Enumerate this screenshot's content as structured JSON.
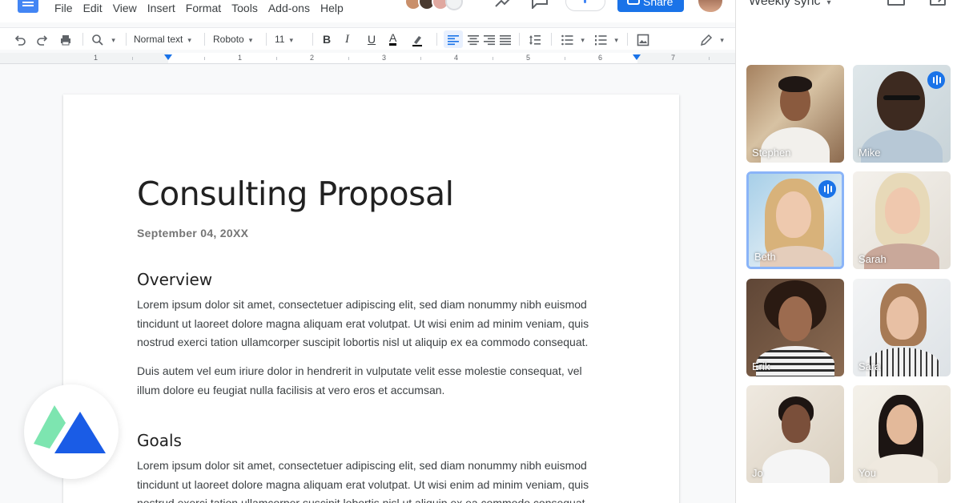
{
  "menubar": {
    "items": [
      "File",
      "Edit",
      "View",
      "Insert",
      "Format",
      "Tools",
      "Add-ons",
      "Help"
    ],
    "share_label": "Share"
  },
  "toolbar": {
    "style_select": "Normal text",
    "font_select": "Roboto",
    "size_select": "11",
    "bold_label": "B",
    "italic_label": "I",
    "underline_label": "U",
    "text_color_label": "A"
  },
  "ruler": {
    "marks": [
      "1",
      "1",
      "2",
      "3",
      "4",
      "5",
      "6",
      "7"
    ]
  },
  "document": {
    "title": "Consulting Proposal",
    "date": "September 04, 20XX",
    "sections": [
      {
        "heading": "Overview",
        "paragraphs": [
          [
            "Lorem ipsum dolor sit amet, consectetuer adipiscing elit, sed diam nonummy nibh euismod",
            "tincidunt ut laoreet dolore magna aliquam erat volutpat. Ut wisi enim ad minim veniam, quis",
            "nostrud exerci tation ullamcorper suscipit lobortis nisl ut aliquip ex ea commodo consequat."
          ],
          [
            "Duis autem vel eum iriure dolor in hendrerit in vulputate velit esse molestie consequat, vel",
            "illum dolore eu feugiat nulla facilisis at vero eros et accumsan."
          ]
        ]
      },
      {
        "heading": "Goals",
        "paragraphs": [
          [
            "Lorem ipsum dolor sit amet, consectetuer adipiscing elit, sed diam nonummy nibh euismod",
            "tincidunt ut laoreet dolore magna aliquam erat volutpat. Ut wisi enim ad minim veniam, quis",
            "nostrud exerci tation ullamcorper suscipit lobortis nisl ut aliquip ex ea commodo consequat."
          ]
        ]
      }
    ]
  },
  "meet": {
    "meeting_title": "Weekly sync",
    "participants": [
      {
        "name": "Stephen",
        "speaking": false
      },
      {
        "name": "Mike",
        "speaking": true
      },
      {
        "name": "Beth",
        "speaking": true
      },
      {
        "name": "Sarah",
        "speaking": false
      },
      {
        "name": "Erik",
        "speaking": false
      },
      {
        "name": "Sara",
        "speaking": false
      },
      {
        "name": "Jo",
        "speaking": false
      },
      {
        "name": "You",
        "speaking": false
      }
    ]
  },
  "colors": {
    "accent": "#1a73e8",
    "speaking_border": "#8ab4f8",
    "logo_green": "#7de5b0",
    "logo_blue": "#1a5ce6"
  }
}
